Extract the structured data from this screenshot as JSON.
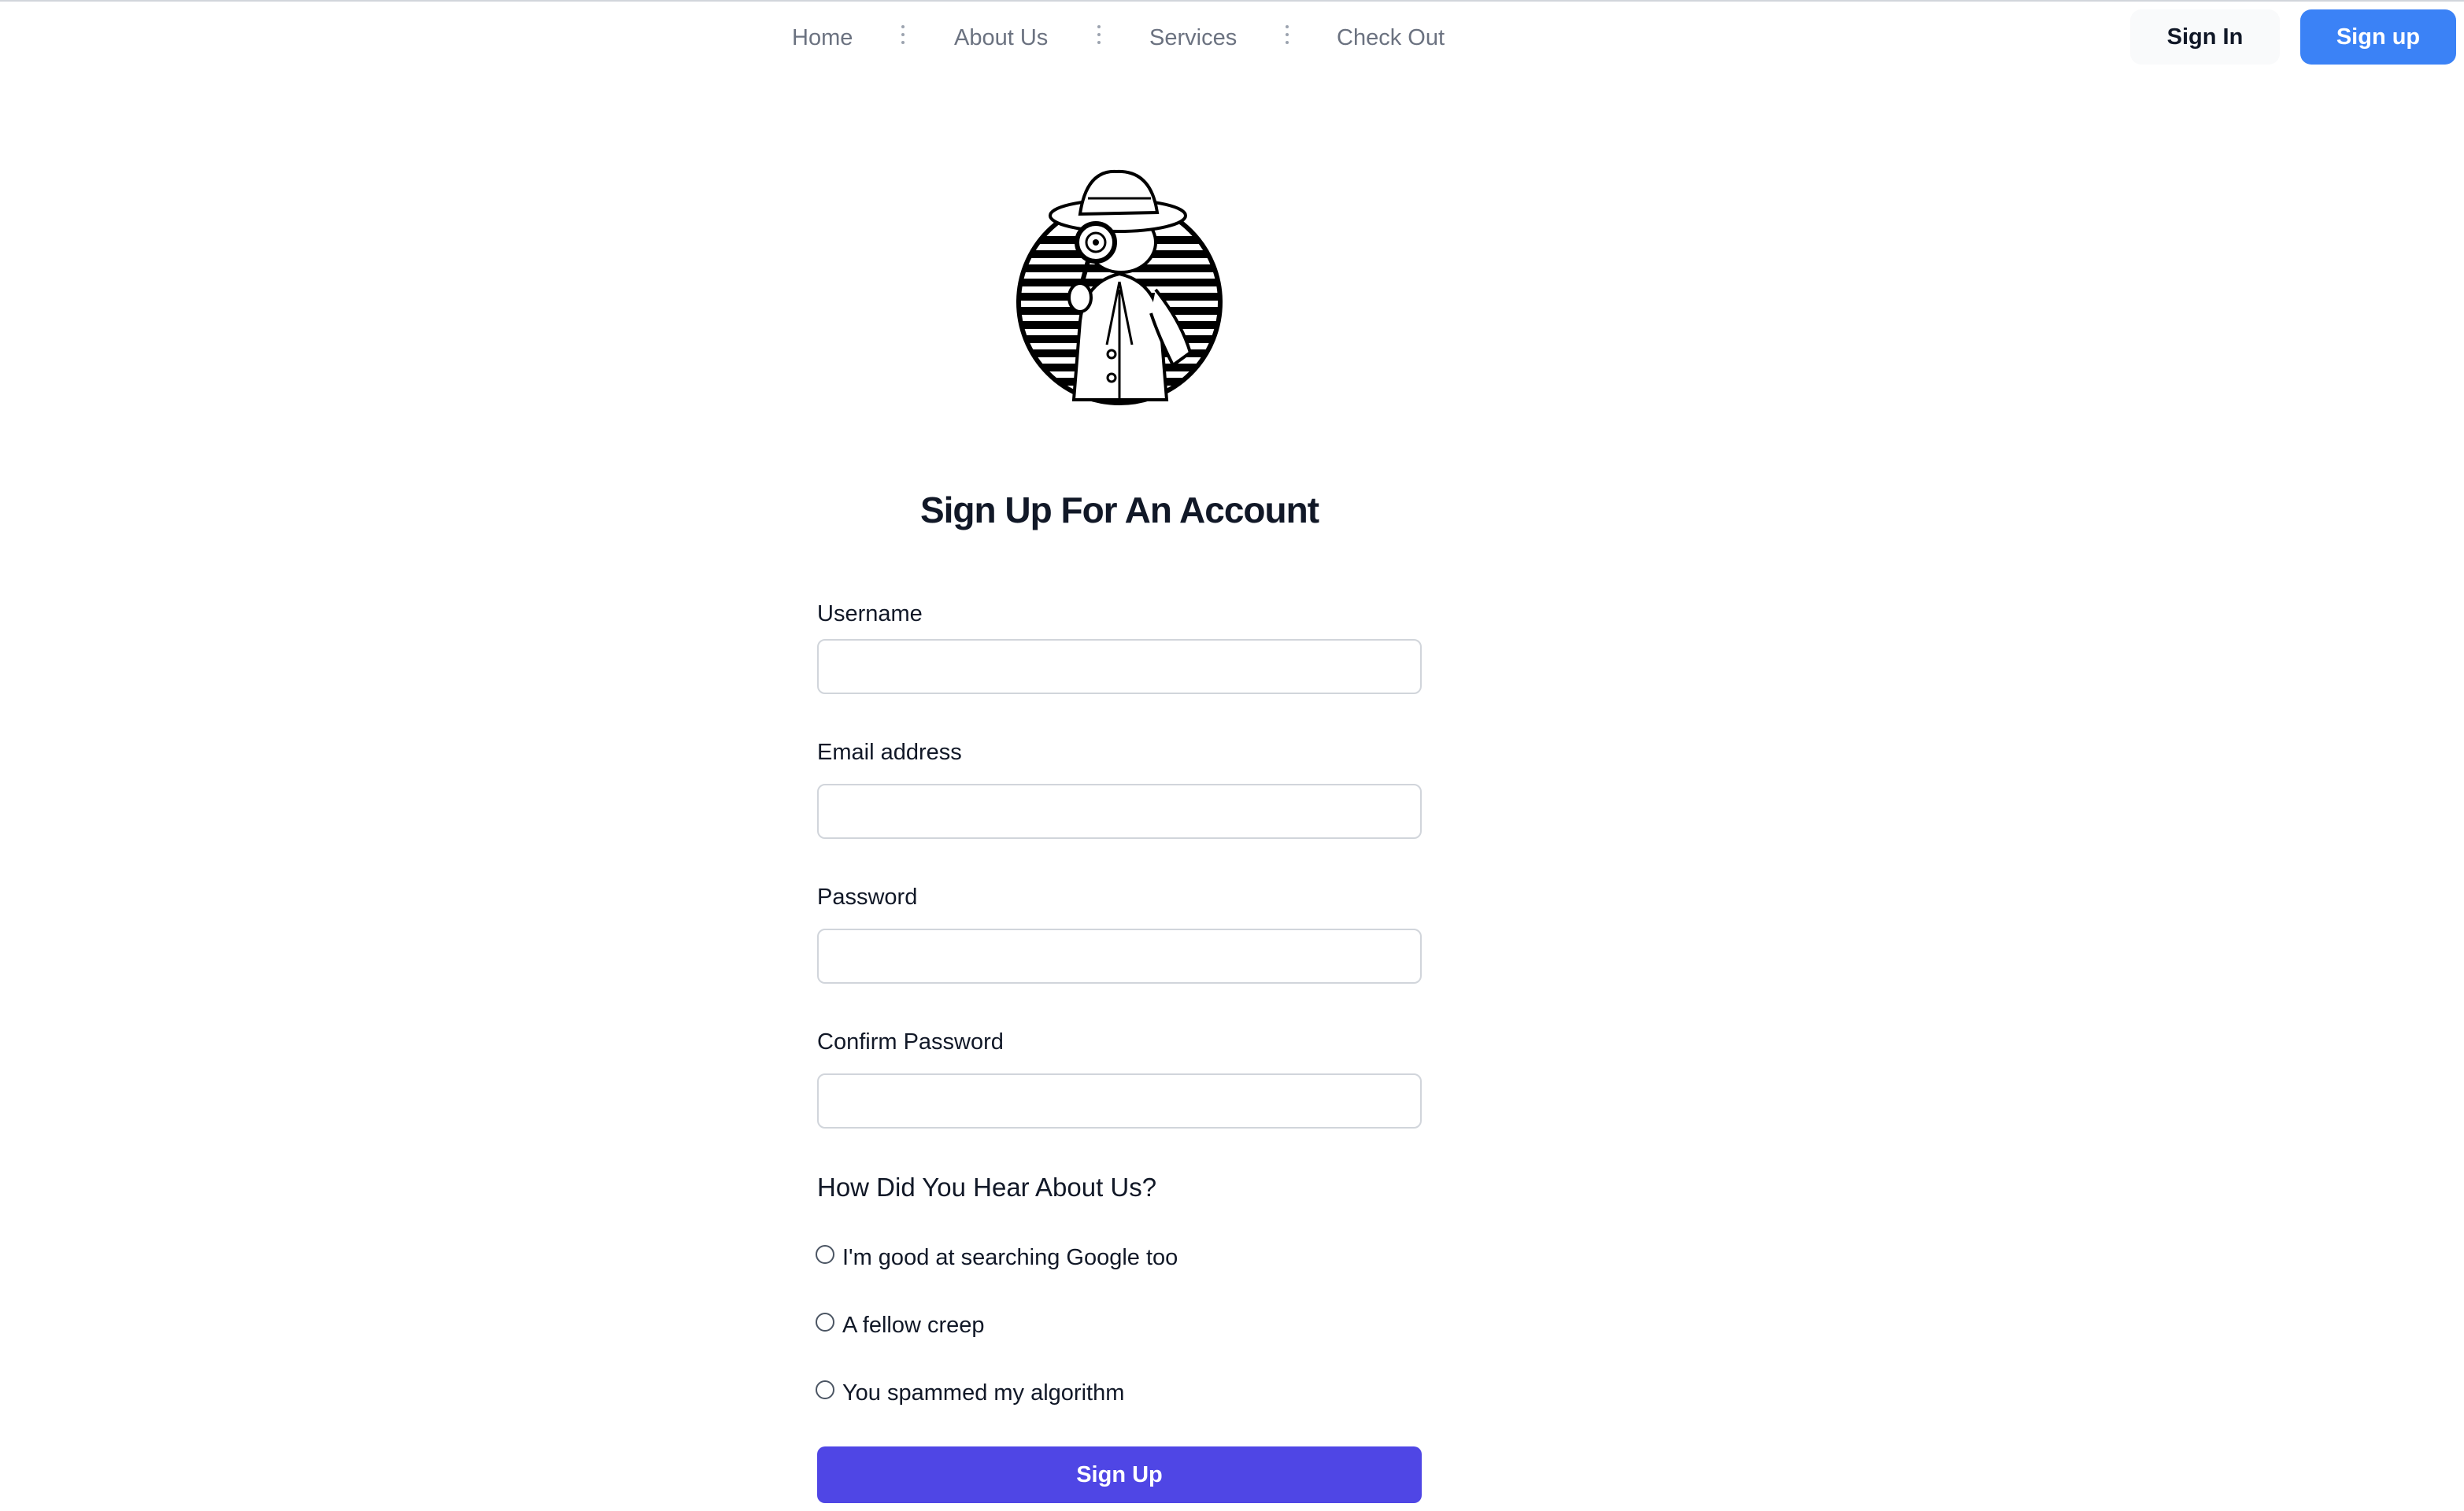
{
  "nav": {
    "links": [
      "Home",
      "About Us",
      "Services",
      "Check Out"
    ],
    "sign_in": "Sign In",
    "sign_up": "Sign up"
  },
  "logo": {
    "icon": "detective-logo-icon"
  },
  "form": {
    "title": "Sign Up For An Account",
    "fields": [
      {
        "label": "Username",
        "value": "",
        "placeholder": ""
      },
      {
        "label": "Email address",
        "value": "",
        "placeholder": ""
      },
      {
        "label": "Password",
        "value": "",
        "placeholder": ""
      },
      {
        "label": "Confirm Password",
        "value": "",
        "placeholder": ""
      }
    ],
    "heard_title": "How Did You Hear About Us?",
    "options": [
      "I'm good at searching Google too",
      "A fellow creep",
      "You spammed my algorithm"
    ],
    "submit": "Sign Up"
  },
  "colors": {
    "primary_button": "#4f46e5",
    "signup_nav_button": "#3b82f6",
    "nav_text": "#6b7280"
  }
}
